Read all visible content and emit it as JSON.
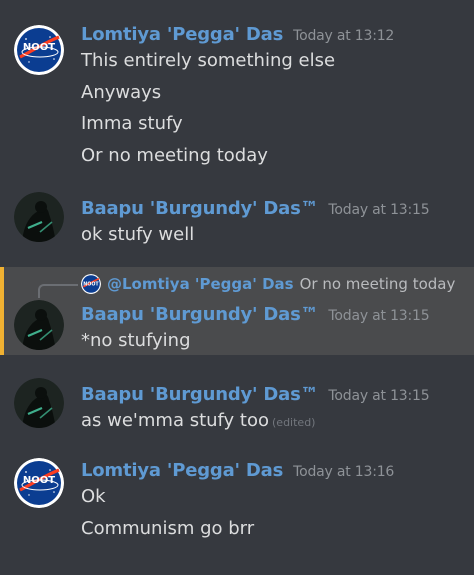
{
  "messages": [
    {
      "author": "Lomtiya 'Pegga' Das",
      "timestamp": "Today at 13:12",
      "lines": [
        "This entirely something else",
        "Anyways",
        "Imma stufy",
        "Or no meeting today"
      ]
    },
    {
      "author": "Baapu 'Burgundy' Das™",
      "timestamp": "Today at 13:15",
      "lines": [
        "ok stufy well"
      ]
    },
    {
      "reply_to": {
        "author": "@Lomtiya 'Pegga' Das",
        "text": "Or no meeting today"
      },
      "author": "Baapu 'Burgundy' Das™",
      "timestamp": "Today at 13:15",
      "lines": [
        "*no stufying"
      ]
    },
    {
      "author": "Baapu 'Burgundy' Das™",
      "timestamp": "Today at 13:15",
      "lines": [
        "as we'mma stufy too"
      ],
      "edited_label": "(edited)"
    },
    {
      "author": "Lomtiya 'Pegga' Das",
      "timestamp": "Today at 13:16",
      "lines": [
        "Ok",
        "Communism go brr"
      ]
    }
  ],
  "avatars": {
    "noot": {
      "icon": "noot-nasa-logo-icon",
      "label": "NOOT",
      "colors": {
        "bg": "#ffffff",
        "disc": "#0b3d91",
        "text": "#ffffff",
        "swoosh": "#fc3d21"
      }
    },
    "dark": {
      "icon": "shadow-figure-avatar-icon",
      "colors": {
        "bg": "#1d2421",
        "figure": "#0b0f0d",
        "glow": "#3fae8c"
      }
    }
  },
  "theme": {
    "author_color": "#5f9ad3",
    "reply_highlight_border": "#f0b132"
  }
}
